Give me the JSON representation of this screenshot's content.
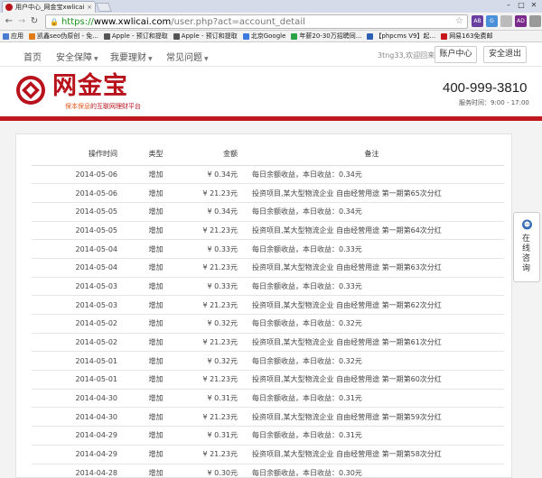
{
  "browser": {
    "tab_title": "用户中心_网金宝xwlicai.c",
    "tab_close": "×",
    "url_scheme": "https://",
    "url_host": "www.xwlicai.com",
    "url_path": "/user.php?act=account_detail",
    "bookmarks": [
      {
        "label": "应用",
        "icon_color": "#4a7bd1"
      },
      {
        "label": "凯鑫seo伪原创 - 免...",
        "icon_color": "#e07b17"
      },
      {
        "label": "Apple - 预订和提取",
        "icon_color": "#555555"
      },
      {
        "label": "Apple - 预订和提取",
        "icon_color": "#555555"
      },
      {
        "label": "北京Google",
        "icon_color": "#3b7be0"
      },
      {
        "label": "年薪20-30万招聘同...",
        "icon_color": "#2aa345"
      },
      {
        "label": "【phpcms V9】起...",
        "icon_color": "#2f5fb3"
      },
      {
        "label": "网易163免费邮",
        "icon_color": "#c8161d"
      }
    ],
    "extensions": [
      {
        "label": "AB",
        "color": "#6b3fa0"
      },
      {
        "label": "G",
        "color": "#4a90d9"
      },
      {
        "label": "",
        "color": "#bbbbbb"
      },
      {
        "label": "AD",
        "color": "#7a2a8a"
      },
      {
        "label": "",
        "color": "#999999"
      },
      {
        "label": "ABP",
        "color": "#aaaaaa"
      }
    ]
  },
  "nav": {
    "items": [
      {
        "label": "首页",
        "caret": ""
      },
      {
        "label": "安全保障",
        "caret": "▼"
      },
      {
        "label": "我要理财",
        "caret": "▼"
      },
      {
        "label": "常见问题",
        "caret": "▼"
      }
    ],
    "welcome": "3tng33,欢迎回来",
    "account_button": "账户中心",
    "logout_button": "安全退出"
  },
  "brand": {
    "name": "网金宝",
    "tagline_highlight": "保本保息",
    "tagline_rest": "的互联网理财平台",
    "phone": "400-999-3810",
    "hours": "服务时间：9:00 - 17:00",
    "color": "#b8131c"
  },
  "table": {
    "headers": {
      "time": "操作时间",
      "type": "类型",
      "amount": "金额",
      "note": "备注"
    },
    "rows": [
      {
        "time": "2014-05-06",
        "type": "增加",
        "amount": "¥ 0.34元",
        "note": "每日余额收益，本日收益：0.34元"
      },
      {
        "time": "2014-05-06",
        "type": "增加",
        "amount": "¥ 21.23元",
        "note": "投资项目,某大型物流企业 自由经营用途 第一期第65次分红"
      },
      {
        "time": "2014-05-05",
        "type": "增加",
        "amount": "¥ 0.34元",
        "note": "每日余额收益，本日收益：0.34元"
      },
      {
        "time": "2014-05-05",
        "type": "增加",
        "amount": "¥ 21.23元",
        "note": "投资项目,某大型物流企业 自由经营用途 第一期第64次分红"
      },
      {
        "time": "2014-05-04",
        "type": "增加",
        "amount": "¥ 0.33元",
        "note": "每日余额收益，本日收益：0.33元"
      },
      {
        "time": "2014-05-04",
        "type": "增加",
        "amount": "¥ 21.23元",
        "note": "投资项目,某大型物流企业 自由经营用途 第一期第63次分红"
      },
      {
        "time": "2014-05-03",
        "type": "增加",
        "amount": "¥ 0.33元",
        "note": "每日余额收益，本日收益：0.33元"
      },
      {
        "time": "2014-05-03",
        "type": "增加",
        "amount": "¥ 21.23元",
        "note": "投资项目,某大型物流企业 自由经营用途 第一期第62次分红"
      },
      {
        "time": "2014-05-02",
        "type": "增加",
        "amount": "¥ 0.32元",
        "note": "每日余额收益，本日收益：0.32元"
      },
      {
        "time": "2014-05-02",
        "type": "增加",
        "amount": "¥ 21.23元",
        "note": "投资项目,某大型物流企业 自由经营用途 第一期第61次分红"
      },
      {
        "time": "2014-05-01",
        "type": "增加",
        "amount": "¥ 0.32元",
        "note": "每日余额收益，本日收益：0.32元"
      },
      {
        "time": "2014-05-01",
        "type": "增加",
        "amount": "¥ 21.23元",
        "note": "投资项目,某大型物流企业 自由经营用途 第一期第60次分红"
      },
      {
        "time": "2014-04-30",
        "type": "增加",
        "amount": "¥ 0.31元",
        "note": "每日余额收益，本日收益：0.31元"
      },
      {
        "time": "2014-04-30",
        "type": "增加",
        "amount": "¥ 21.23元",
        "note": "投资项目,某大型物流企业 自由经营用途 第一期第59次分红"
      },
      {
        "time": "2014-04-29",
        "type": "增加",
        "amount": "¥ 0.31元",
        "note": "每日余额收益，本日收益：0.31元"
      },
      {
        "time": "2014-04-29",
        "type": "增加",
        "amount": "¥ 21.23元",
        "note": "投资项目,某大型物流企业 自由经营用途 第一期第58次分红"
      },
      {
        "time": "2014-04-28",
        "type": "增加",
        "amount": "¥ 0.30元",
        "note": "每日余额收益，本日收益：0.30元"
      }
    ]
  },
  "consult": {
    "label": "在线咨询"
  }
}
